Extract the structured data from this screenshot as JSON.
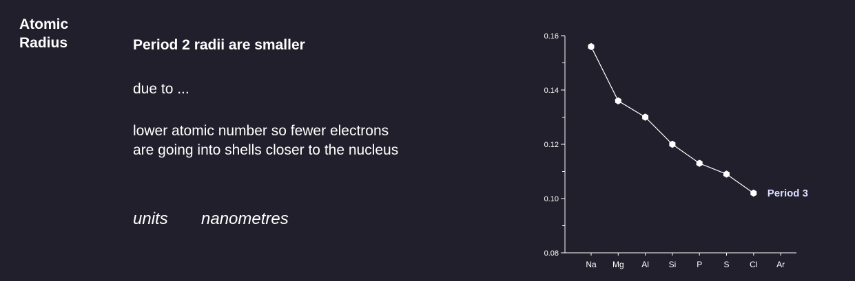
{
  "slide": {
    "section_title": "Atomic Radius",
    "heading": "Period 2 radii are smaller",
    "due_to": "due to ...",
    "explanation_line1": "lower atomic number so fewer electrons",
    "explanation_line2": "are going into shells closer to the nucleus",
    "units_label": "units",
    "units_value": "nanometres"
  },
  "chart_data": {
    "type": "line",
    "categories": [
      "Na",
      "Mg",
      "Al",
      "Si",
      "P",
      "S",
      "Cl",
      "Ar"
    ],
    "series": [
      {
        "name": "Period 3",
        "values": [
          0.156,
          0.136,
          0.13,
          0.12,
          0.113,
          0.109,
          0.102,
          null
        ]
      }
    ],
    "yticks": [
      "0.08",
      "0.10",
      "0.12",
      "0.14",
      "0.16"
    ],
    "ylim": [
      0.08,
      0.16
    ],
    "grid": false,
    "legend": "inline label at end of series",
    "colors": {
      "line": "#ffffff",
      "marker": "#ffffff",
      "series_label": "#dcdcff",
      "axis": "#ffffff",
      "background": "#211f2b"
    }
  }
}
